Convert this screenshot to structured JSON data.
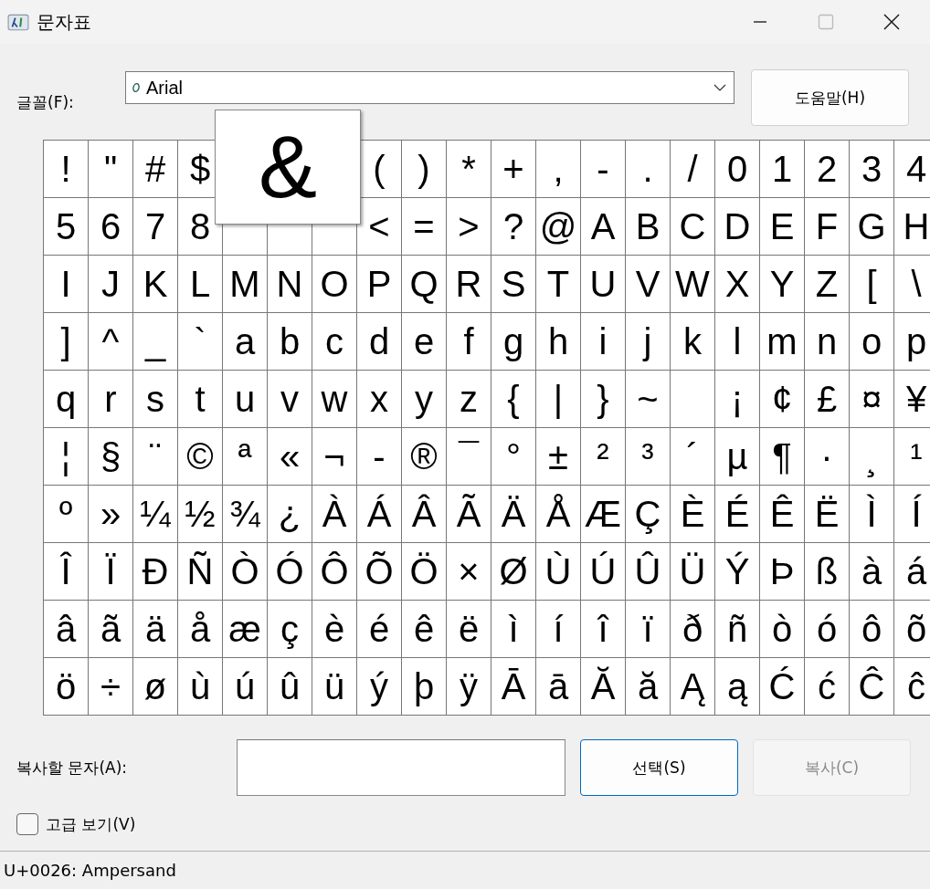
{
  "window": {
    "title": "문자표"
  },
  "font": {
    "label": "글꼴(F):",
    "value": "Arial"
  },
  "help_button": {
    "label": "도움말(H)"
  },
  "grid": {
    "rows": [
      [
        "!",
        "\"",
        "#",
        "$",
        null,
        null,
        null,
        "(",
        ")",
        "*",
        "+",
        ",",
        "-",
        ".",
        "/",
        "0",
        "1",
        "2",
        "3",
        "4"
      ],
      [
        "5",
        "6",
        "7",
        "8",
        {
          "kind": "blank"
        },
        {
          "kind": "blank"
        },
        {
          "kind": "blank"
        },
        "<",
        "=",
        ">",
        "?",
        "@",
        "A",
        "B",
        "C",
        "D",
        "E",
        "F",
        "G",
        "H"
      ],
      [
        "I",
        "J",
        "K",
        "L",
        "M",
        "N",
        "O",
        "P",
        "Q",
        "R",
        "S",
        "T",
        "U",
        "V",
        "W",
        "X",
        "Y",
        "Z",
        "[",
        "\\"
      ],
      [
        "]",
        "^",
        "_",
        "`",
        "a",
        "b",
        "c",
        "d",
        "e",
        "f",
        "g",
        "h",
        "i",
        "j",
        "k",
        "l",
        "m",
        "n",
        "o",
        "p"
      ],
      [
        "q",
        "r",
        "s",
        "t",
        "u",
        "v",
        "w",
        "x",
        "y",
        "z",
        "{",
        "|",
        "}",
        "~",
        {
          "kind": "blank"
        },
        "¡",
        "¢",
        "£",
        "¤",
        "¥"
      ],
      [
        "¦",
        "§",
        "¨",
        "©",
        "ª",
        "«",
        "¬",
        "-",
        "®",
        "¯",
        "°",
        "±",
        "²",
        "³",
        "´",
        "µ",
        "¶",
        "·",
        "¸",
        "¹"
      ],
      [
        "º",
        "»",
        "¼",
        "½",
        "¾",
        "¿",
        "À",
        "Á",
        "Â",
        "Ã",
        "Ä",
        "Å",
        "Æ",
        "Ç",
        "È",
        "É",
        "Ê",
        "Ë",
        "Ì",
        "Í"
      ],
      [
        "Î",
        "Ï",
        "Ð",
        "Ñ",
        "Ò",
        "Ó",
        "Ô",
        "Õ",
        "Ö",
        "×",
        "Ø",
        "Ù",
        "Ú",
        "Û",
        "Ü",
        "Ý",
        "Þ",
        "ß",
        "à",
        "á"
      ],
      [
        "â",
        "ã",
        "ä",
        "å",
        "æ",
        "ç",
        "è",
        "é",
        "ê",
        "ë",
        "ì",
        "í",
        "î",
        "ï",
        "ð",
        "ñ",
        "ò",
        "ó",
        "ô",
        "õ"
      ],
      [
        "ö",
        "÷",
        "ø",
        "ù",
        "ú",
        "û",
        "ü",
        "ý",
        "þ",
        "ÿ",
        "Ā",
        "ā",
        "Ă",
        "ă",
        "Ą",
        "ą",
        "Ć",
        "ć",
        "Ĉ",
        "ĉ"
      ]
    ],
    "magnified": "&"
  },
  "copy_field": {
    "label": "복사할 문자(A):"
  },
  "select_button": {
    "label": "선택(S)",
    "focused": true
  },
  "copy_button": {
    "label": "복사(C)",
    "disabled": true
  },
  "advanced_view": {
    "label": "고급 보기(V)",
    "checked": false
  },
  "status_bar": "U+0026: Ampersand"
}
